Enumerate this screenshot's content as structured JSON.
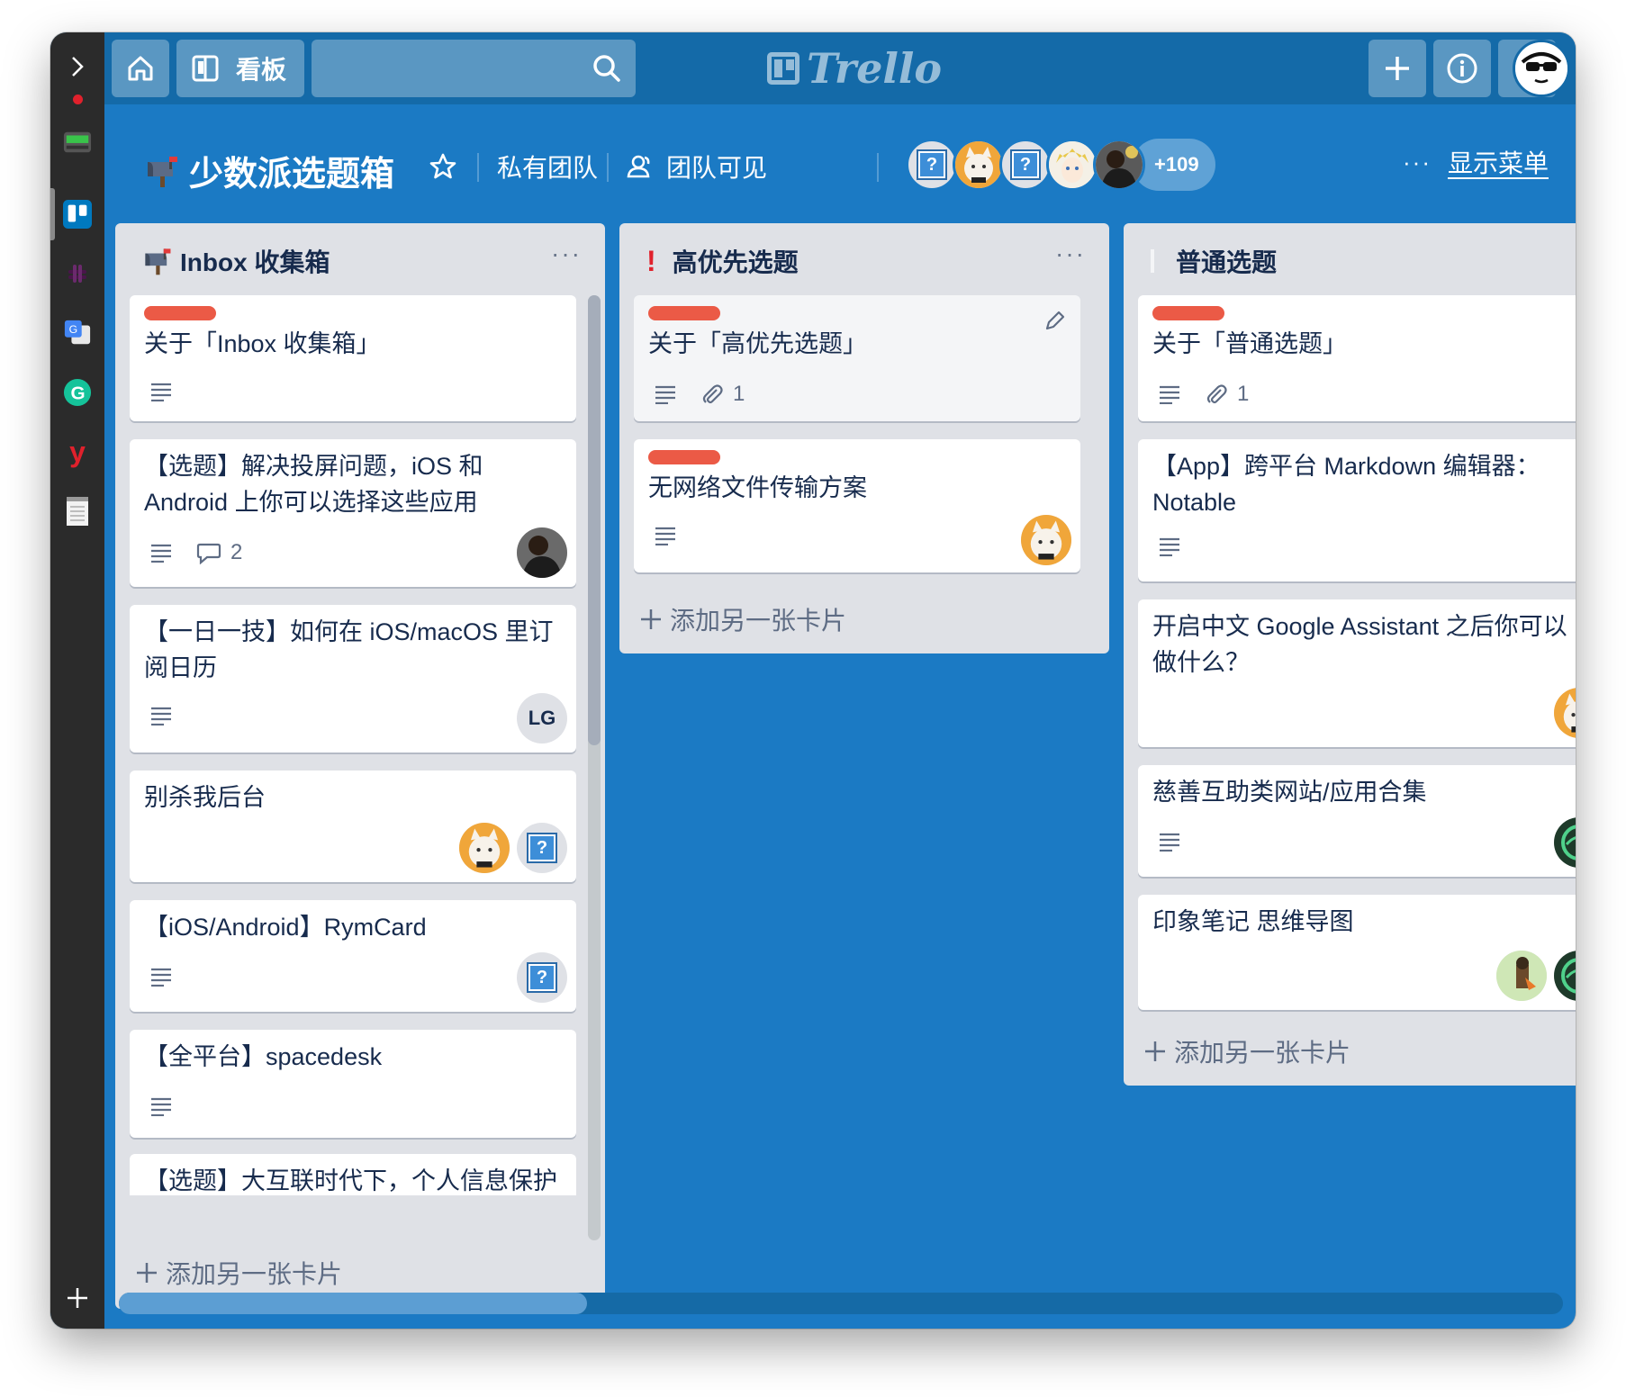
{
  "header": {
    "boards_label": "看板",
    "logo_text": "Trello"
  },
  "board": {
    "title": "少数派选题箱",
    "team_label": "私有团队",
    "visibility_label": "团队可见",
    "more_members": "+109",
    "show_menu": "显示菜单"
  },
  "colors": {
    "board_bg": "#1b7ac4",
    "header_bg": "#146aa8",
    "label_red": "#eb5a46",
    "list_bg": "#dfe1e6"
  },
  "lists": [
    {
      "title": "Inbox 收集箱",
      "add_card": "添加另一张卡片",
      "cards": [
        {
          "title": "关于「Inbox 收集箱」"
        },
        {
          "title": "【选题】解决投屏问题，iOS 和 Android 上你可以选择这些应用",
          "comments": "2"
        },
        {
          "title": "【一日一技】如何在 iOS/macOS 里订阅日历",
          "member_initials": "LG"
        },
        {
          "title": "别杀我后台"
        },
        {
          "title": "【iOS/Android】RymCard"
        },
        {
          "title": "【全平台】spacedesk"
        },
        {
          "title": "【选题】大互联时代下，个人信息保护的一些方法"
        }
      ]
    },
    {
      "title": "高优先选题",
      "add_card": "添加另一张卡片",
      "cards": [
        {
          "title": "关于「高优先选题」",
          "attachments": "1"
        },
        {
          "title": "无网络文件传输方案"
        }
      ]
    },
    {
      "title": "普通选题",
      "add_card": "添加另一张卡片",
      "cards": [
        {
          "title": "关于「普通选题」",
          "attachments": "1"
        },
        {
          "title": "【App】跨平台 Markdown 编辑器：Notable"
        },
        {
          "title": "开启中文 Google Assistant 之后你可以做什么？"
        },
        {
          "title": "慈善互助类网站/应用合集"
        },
        {
          "title": "印象笔记 思维导图"
        }
      ]
    }
  ]
}
